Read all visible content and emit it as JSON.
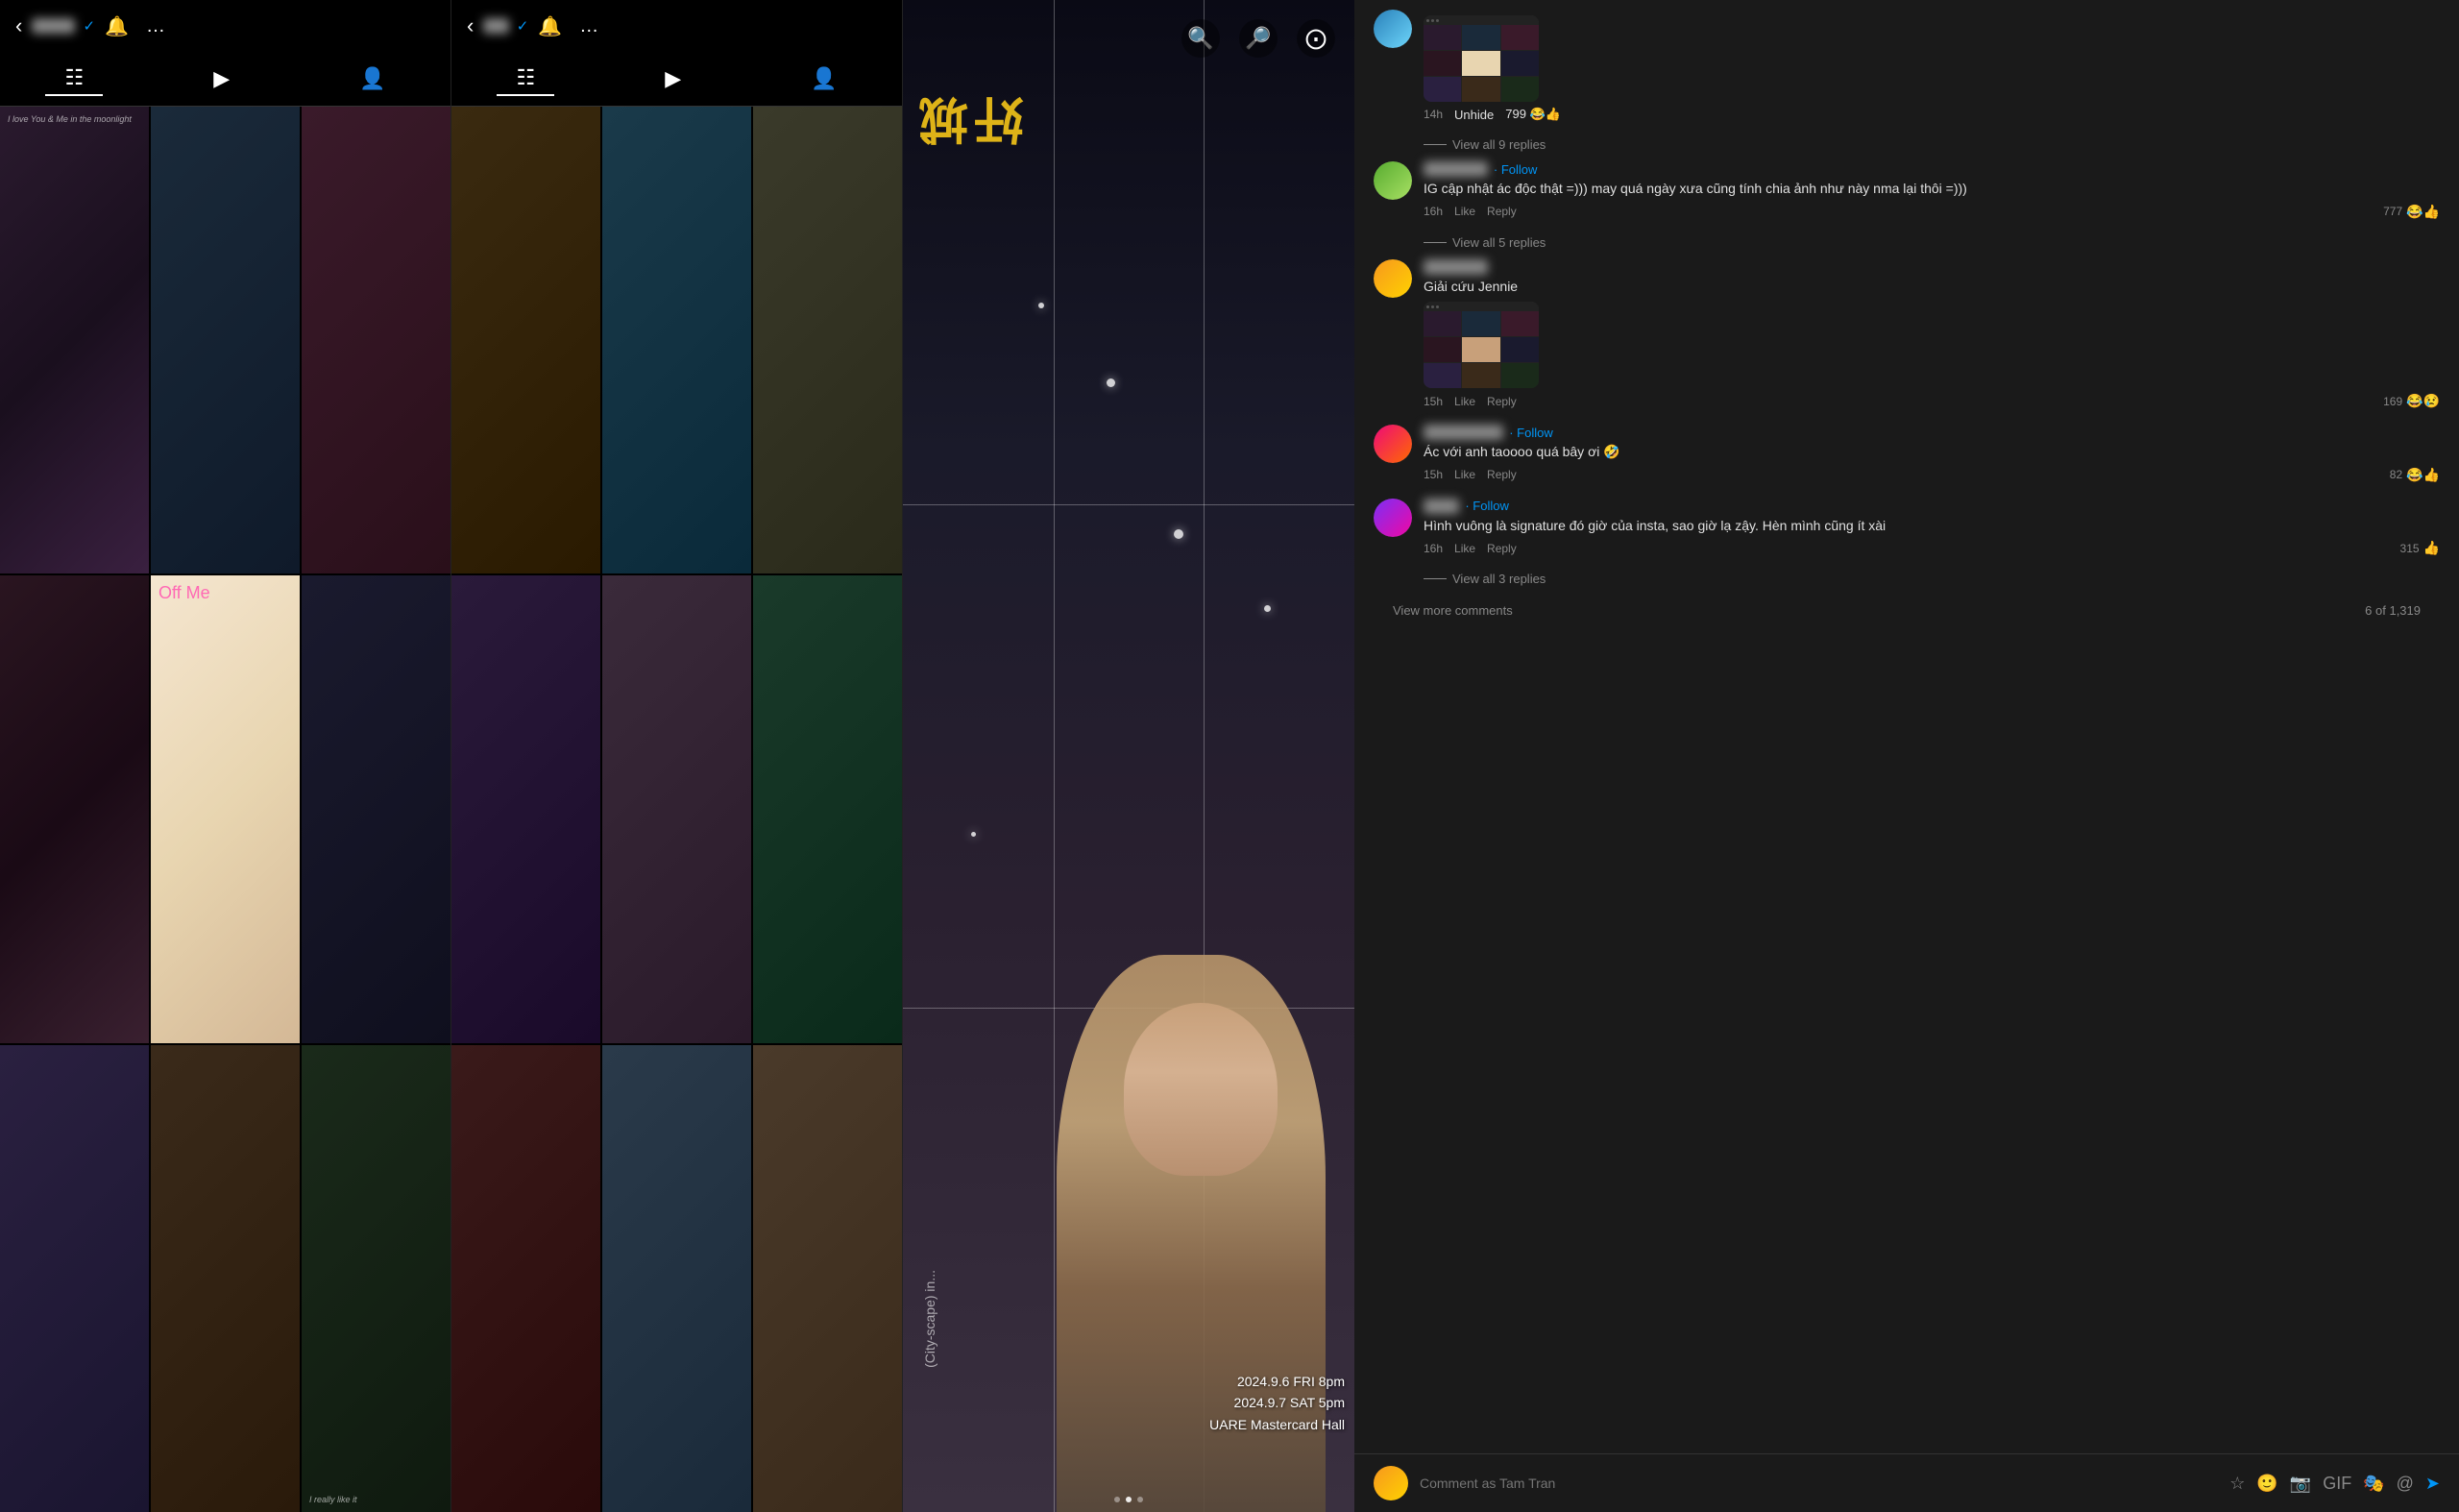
{
  "panels": {
    "left": {
      "username": "official",
      "username_blurred": true,
      "verified": true,
      "nav": [
        "grid",
        "reels",
        "profile"
      ],
      "grid_cells": [
        {
          "color": "c1",
          "text": "I love You & Me in the moonlight",
          "text_pos": "top-left"
        },
        {
          "color": "c2"
        },
        {
          "color": "c3"
        },
        {
          "color": "c4"
        },
        {
          "color": "c5",
          "text": "Off Me"
        },
        {
          "color": "c6"
        },
        {
          "color": "c7"
        },
        {
          "color": "c8"
        },
        {
          "color": "c9",
          "text": "I really like it",
          "text_pos": "bottom-left"
        }
      ]
    },
    "middle": {
      "username": "wea",
      "username_blurred": true,
      "verified": true,
      "nav": [
        "grid",
        "reels",
        "profile"
      ],
      "grid_cells": [
        {
          "color": "m1"
        },
        {
          "color": "m2"
        },
        {
          "color": "m3"
        },
        {
          "color": "m4"
        },
        {
          "color": "m5"
        },
        {
          "color": "m6"
        },
        {
          "color": "m7"
        },
        {
          "color": "m8"
        },
        {
          "color": "m9"
        }
      ]
    },
    "expanded_image": {
      "yellow_text": "城奸",
      "vertical_label": "(City-scape) in...",
      "event_lines": [
        "2024.9.6 FRI 8pm",
        "2024.9.7 SAT 5pm",
        "UARE Mastercard Hall"
      ]
    }
  },
  "comments": {
    "first_comment": {
      "time": "14h",
      "unhide_label": "Unhide",
      "count": "799",
      "reactions": "😂👍",
      "view_replies_label": "View all 9 replies"
    },
    "items": [
      {
        "id": "c1",
        "author": "Nguyễn",
        "author_rest": "...",
        "author_blurred": true,
        "follow_label": "Follow",
        "text": "· Follow\nIG cập nhật ác độc thật =))) may quá ngày xưa cũng tính chia ảnh như này nma lại thôi =)))",
        "time": "16h",
        "like_label": "Like",
        "reply_label": "Reply",
        "count": "777",
        "reactions": "😂👍",
        "view_replies_label": "View all 5 replies",
        "avatar_class": "avatar-green"
      },
      {
        "id": "c2",
        "author": "Nguyễn",
        "author_rest": "...",
        "author_blurred": true,
        "text": "Giải cứu Jennie",
        "time": "15h",
        "like_label": "Like",
        "reply_label": "Reply",
        "count": "169",
        "reactions": "😂😢",
        "has_thumbnail": true,
        "avatar_class": "avatar-orange"
      },
      {
        "id": "c3",
        "author": "Chút ch",
        "author_mid": "uiz",
        "author_blurred": true,
        "follow_label": "Follow",
        "text": "Ác với anh taoooo quá bây ơi 🤣",
        "time": "15h",
        "like_label": "Like",
        "reply_label": "Reply",
        "count": "82",
        "reactions": "😂👍",
        "avatar_class": "avatar-pink"
      },
      {
        "id": "c4",
        "author": "H",
        "author_mid": "lie",
        "author_blurred": true,
        "follow_label": "Follow",
        "text": "Hình vuông là signature đó giờ của insta, sao giờ lạ zậy. Hèn mình cũng ít xài",
        "time": "16h",
        "like_label": "Like",
        "reply_label": "Reply",
        "count": "315",
        "reactions": "👍",
        "view_replies_label": "View all 3 replies",
        "avatar_class": "avatar-purple"
      }
    ],
    "view_more": {
      "label": "View more comments",
      "count_label": "6 of 1,319"
    },
    "input": {
      "placeholder": "Comment as Tam Tran",
      "icons": [
        "star",
        "emoji",
        "camera",
        "gif",
        "sticker",
        "at"
      ]
    }
  }
}
